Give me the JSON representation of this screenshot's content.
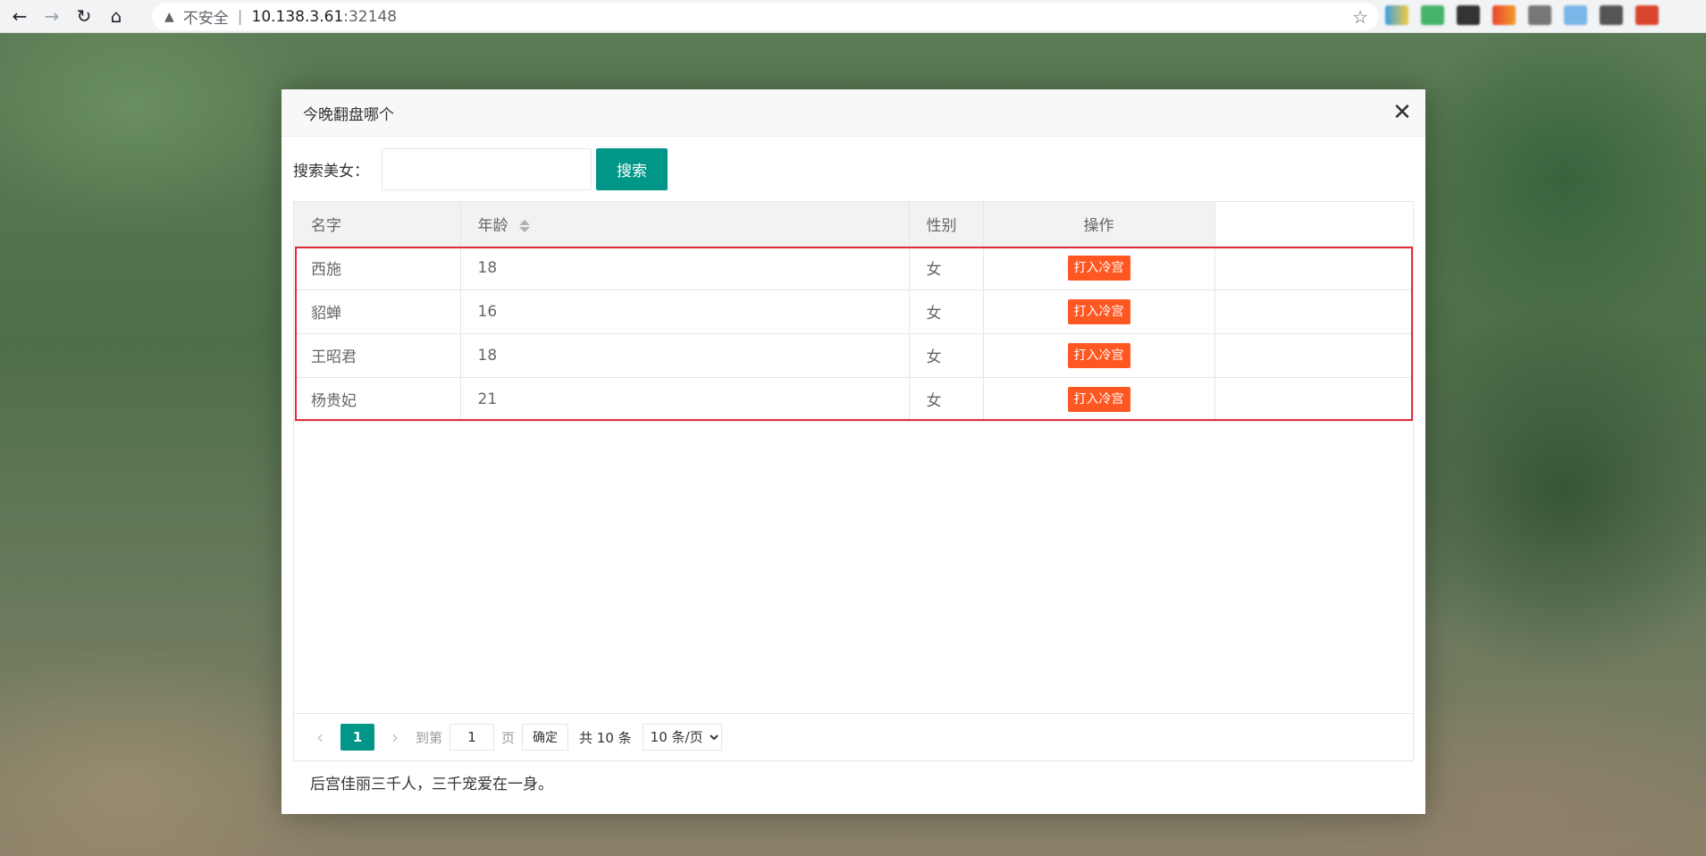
{
  "browser": {
    "security_label": "不安全",
    "url_host": "10.138.3.61",
    "url_port": ":32148"
  },
  "modal": {
    "title": "今晚翻盘哪个",
    "search_label": "搜索美女：",
    "search_value": "",
    "search_button": "搜索",
    "columns": [
      "名字",
      "年龄",
      "性别",
      "操作"
    ],
    "rows": [
      {
        "name": "西施",
        "age": "18",
        "gender": "女",
        "action": "打入冷宫"
      },
      {
        "name": "貂蝉",
        "age": "16",
        "gender": "女",
        "action": "打入冷宫"
      },
      {
        "name": "王昭君",
        "age": "18",
        "gender": "女",
        "action": "打入冷宫"
      },
      {
        "name": "杨贵妃",
        "age": "21",
        "gender": "女",
        "action": "打入冷宫"
      }
    ],
    "pager": {
      "current": "1",
      "goto_label": "到第",
      "goto_value": "1",
      "page_unit": "页",
      "confirm": "确定",
      "total": "共 10 条",
      "page_size": "10 条/页"
    },
    "footer": "后宫佳丽三千人，三千宠爱在一身。"
  },
  "colors": {
    "primary": "#009688",
    "danger_button": "#ff5722",
    "highlight_border": "#e02d3a"
  }
}
